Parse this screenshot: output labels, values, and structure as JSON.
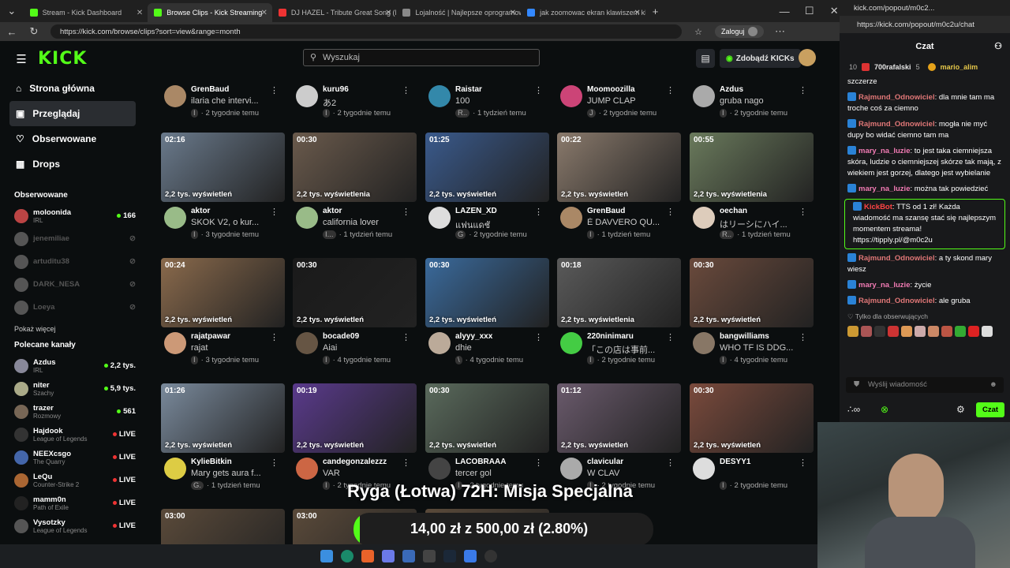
{
  "browser": {
    "tabs": [
      {
        "label": "Stream - Kick Dashboard",
        "active": false
      },
      {
        "label": "Browse Clips - Kick Streaming",
        "active": true
      },
      {
        "label": "DJ HAZEL - Tribute Great Song (M",
        "active": false
      },
      {
        "label": "Lojalność | Najlepsze oprogramow",
        "active": false
      },
      {
        "label": "jak zoomowac ekran klawiszem kl",
        "active": false
      }
    ],
    "url": "https://kick.com/browse/clips?sort=view&range=month",
    "login": "Zaloguj"
  },
  "kick": {
    "logo": "KICK",
    "search_placeholder": "Wyszukaj",
    "kicks_button": "Zdobądź KICKs",
    "nav": [
      {
        "label": "Strona główna",
        "icon": "home-icon"
      },
      {
        "label": "Przeglądaj",
        "icon": "browse-icon"
      },
      {
        "label": "Obserwowane",
        "icon": "heart-icon"
      },
      {
        "label": "Drops",
        "icon": "drops-icon"
      }
    ],
    "followed_title": "Obserwowane",
    "followed": [
      {
        "name": "moloonida",
        "sub": "IRL",
        "count": "166",
        "online": true,
        "color": "#b44"
      },
      {
        "name": "jenemiliae",
        "online": false,
        "color": "#555"
      },
      {
        "name": "artuditu38",
        "online": false,
        "color": "#555"
      },
      {
        "name": "DARK_NESA",
        "online": false,
        "color": "#555"
      },
      {
        "name": "Loeya",
        "online": false,
        "color": "#555"
      }
    ],
    "show_more": "Pokaż więcej",
    "recommended_title": "Polecane kanały",
    "recommended": [
      {
        "name": "Azdus",
        "sub": "IRL",
        "count": "2,2 tys.",
        "color": "#889"
      },
      {
        "name": "niter",
        "sub": "Szachy",
        "count": "5,9 tys.",
        "color": "#aa8"
      },
      {
        "name": "trazer",
        "sub": "Rozmowy",
        "count": "561",
        "color": "#765"
      },
      {
        "name": "Hajdook",
        "sub": "League of Legends",
        "count": "LIVE",
        "color": "#333"
      },
      {
        "name": "NEEXcsgo",
        "sub": "The Quarry",
        "count": "LIVE",
        "color": "#46a"
      },
      {
        "name": "LeQu",
        "sub": "Counter-Strike 2",
        "count": "LIVE",
        "color": "#a63"
      },
      {
        "name": "mamm0n",
        "sub": "Path of Exile",
        "count": "LIVE",
        "color": "#222"
      },
      {
        "name": "Vysotzky",
        "sub": "League of Legends",
        "count": "LIVE",
        "color": "#555"
      }
    ],
    "row0": [
      {
        "channel": "GrenBaud",
        "title": "ilaria che intervi...",
        "time": "2 tygodnie temu",
        "badge": "I"
      },
      {
        "channel": "kuru96",
        "title": "あ2",
        "time": "2 tygodnie temu",
        "badge": "I"
      },
      {
        "channel": "Raistar",
        "title": "100",
        "time": "1 tydzień temu",
        "badge": "R.."
      },
      {
        "channel": "Moomoozilla",
        "title": "JUMP CLAP",
        "time": "2 tygodnie temu",
        "badge": "J"
      },
      {
        "channel": "Azdus",
        "title": "gruba nago",
        "time": "2 tygodnie temu",
        "badge": "I"
      }
    ],
    "clips": [
      {
        "dur": "02:16",
        "views": "2,2 tys. wyświetleń",
        "channel": "aktor",
        "title": "SKOK V2, o kur...",
        "time": "3 tygodnie temu",
        "badge": "I",
        "thumb": "#6a7a8c",
        "av": "#9b8"
      },
      {
        "dur": "00:30",
        "views": "2,2 tys. wyświetlenia",
        "channel": "aktor",
        "title": "california lover",
        "time": "1 tydzień temu",
        "badge": "I...",
        "thumb": "#6a5a4c",
        "av": "#9b8"
      },
      {
        "dur": "01:25",
        "views": "2,2 tys. wyświetleń",
        "channel": "LAZEN_XD",
        "title": "แฟนแดชั",
        "time": "2 tygodnie temu",
        "badge": "G",
        "thumb": "#3a5a8c",
        "av": "#ddd"
      },
      {
        "dur": "00:22",
        "views": "2,2 tys. wyświetleń",
        "channel": "GrenBaud",
        "title": "È DAVVERO QU...",
        "time": "1 tydzień temu",
        "badge": "I",
        "thumb": "#8a7a6c",
        "av": "#a86"
      },
      {
        "dur": "00:55",
        "views": "2,2 tys. wyświetlenia",
        "channel": "oechan",
        "title": "はリーシにハイ...",
        "time": "1 tydzień temu",
        "badge": "R..",
        "thumb": "#6a7a5c",
        "av": "#dcb"
      },
      {
        "dur": "00:24",
        "views": "2,2 tys. wyświetleń",
        "channel": "rajatpawar",
        "title": "rajat",
        "time": "3 tygodnie temu",
        "badge": "I",
        "thumb": "#8a6a4c",
        "av": "#c97"
      },
      {
        "dur": "00:30",
        "views": "2,2 tys. wyświetleń",
        "channel": "bocade09",
        "title": "Aiai",
        "time": "4 tygodnie temu",
        "badge": "I",
        "thumb": "#1a1a1a",
        "av": "#654"
      },
      {
        "dur": "00:30",
        "views": "2,2 tys. wyświetleń",
        "channel": "alyyy_xxx",
        "title": "dhie",
        "time": "4 tygodnie temu",
        "badge": "\\",
        "thumb": "#3a6a9c",
        "av": "#ba9"
      },
      {
        "dur": "00:18",
        "views": "2,2 tys. wyświetlenia",
        "channel": "220ninimaru",
        "title": "「この店は事前...",
        "time": "2 tygodnie temu",
        "badge": "I",
        "thumb": "#5a5a5a",
        "av": "#4c4"
      },
      {
        "dur": "00:30",
        "views": "2,2 tys. wyświetleń",
        "channel": "bangwilliams",
        "title": "WHO TF IS DDG...",
        "time": "4 tygodnie temu",
        "badge": "I",
        "thumb": "#6a4a3c",
        "av": "#876"
      },
      {
        "dur": "01:26",
        "views": "2,2 tys. wyświetleń",
        "channel": "KylieBitkin",
        "title": "Mary gets aura f...",
        "time": "1 tydzień temu",
        "badge": "G.",
        "thumb": "#7a8a9c",
        "av": "#dc4"
      },
      {
        "dur": "00:19",
        "views": "2,2 tys. wyświetleń",
        "channel": "candegonzalezzz",
        "title": "VAR",
        "time": "2 tygodnie temu",
        "badge": "I",
        "thumb": "#5a3a8c",
        "av": "#c64"
      },
      {
        "dur": "00:30",
        "views": "2,2 tys. wyświetleń",
        "channel": "LACOBRAAA",
        "title": "tercer gol",
        "time": "2 tygodnie temu",
        "badge": "I",
        "thumb": "#5a6a5c",
        "av": "#444"
      },
      {
        "dur": "01:12",
        "views": "2,2 tys. wyświetleń",
        "channel": "clavicular",
        "title": "W CLAV",
        "time": "2 tygodnie temu",
        "badge": "I",
        "thumb": "#6a5a6c",
        "av": "#aaa"
      },
      {
        "dur": "00:30",
        "views": "2,2 tys. wyświetleń",
        "channel": "DESYY1",
        "title": "",
        "time": "2 tygodnie temu",
        "badge": "I",
        "thumb": "#7a4a3c",
        "av": "#ddd"
      }
    ],
    "bottom_durs": [
      "03:00",
      "03:00",
      "00:36"
    ]
  },
  "chat": {
    "tab_url": "kick.com/popout/m0c2...",
    "url": "https://kick.com/popout/m0c2u/chat",
    "title": "Czat",
    "rank1": "10",
    "rank2": "700rafalski",
    "rank2n": "5",
    "rank3": "mario_alim",
    "messages": [
      {
        "user": "",
        "text": "szczerze",
        "color": "#fff"
      },
      {
        "user": "Rajmund_Odnowiciel",
        "text": "dla mnie tam ma troche coś za ciemno",
        "color": "#e07777"
      },
      {
        "user": "Rajmund_Odnowiciel",
        "text": "mogła nie myć dupy bo widać ciemno tam ma",
        "color": "#e07777"
      },
      {
        "user": "mary_na_luzie",
        "text": "to jest taka ciemniejsza skóra, ludzie o ciemniejszej skórze tak mają, z wiekiem jest gorzej, dlatego jest wybielanie",
        "color": "#f27bb4"
      },
      {
        "user": "mary_na_luzie",
        "text": "można tak powiedzieć",
        "color": "#f27bb4"
      },
      {
        "user": "KickBot",
        "text": "TTS od 1 zł! Każda wiadomość ma szansę stać się najlepszym momentem streama! https://tipply.pl/@m0c2u",
        "color": "#ff4444"
      },
      {
        "user": "Rajmund_Odnowiciel",
        "text": "a ty skond mary wiesz",
        "color": "#e07777"
      },
      {
        "user": "mary_na_luzie",
        "text": "życie",
        "color": "#f27bb4"
      },
      {
        "user": "Rajmund_Odnowiciel",
        "text": "ale gruba",
        "color": "#e07777"
      }
    ],
    "followers_only": "Tylko dla obserwujących",
    "input_placeholder": "Wyślij wiadomość",
    "send": "Czat"
  },
  "overlay": {
    "title": "Ryga (Łotwa) 72H: Misja Specjalna",
    "goal_text": "14,00 zł z 500,00 zł (2.80%)",
    "progress": 0.028
  }
}
